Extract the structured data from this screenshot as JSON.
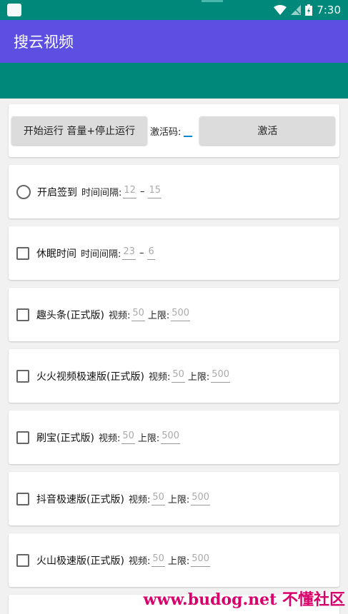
{
  "status_bar": {
    "time": "7:30"
  },
  "app": {
    "title": "搜云视频"
  },
  "controls": {
    "start_stop_label": "开始运行 音量+停止运行",
    "activation_label": "激活码:",
    "activation_value": "",
    "activate_label": "激活"
  },
  "sign_in": {
    "label": "开启签到",
    "interval_label": "时间间隔:",
    "from": "12",
    "dash": "–",
    "to": "15"
  },
  "sleep": {
    "label": "休眠时间",
    "interval_label": "时间间隔:",
    "from": "23",
    "dash": "–",
    "to": "6"
  },
  "apps": [
    {
      "name": "趣头条(正式版)",
      "video_label": "视频:",
      "video": "50",
      "limit_label": "上限:",
      "limit": "500"
    },
    {
      "name": "火火视频极速版(正式版)",
      "video_label": "视频:",
      "video": "50",
      "limit_label": "上限:",
      "limit": "500"
    },
    {
      "name": "刷宝(正式版)",
      "video_label": "视频:",
      "video": "50",
      "limit_label": "上限:",
      "limit": "500"
    },
    {
      "name": "抖音极速版(正式版)",
      "video_label": "视频:",
      "video": "50",
      "limit_label": "上限:",
      "limit": "500"
    },
    {
      "name": "火山极速版(正式版)",
      "video_label": "视频:",
      "video": "50",
      "limit_label": "上限:",
      "limit": "500"
    }
  ],
  "watermark": {
    "text": "www.budog.net 不懂社区"
  },
  "colors": {
    "primary": "#5c4fe2",
    "teal": "#00897b",
    "accent": "#0288d1"
  }
}
